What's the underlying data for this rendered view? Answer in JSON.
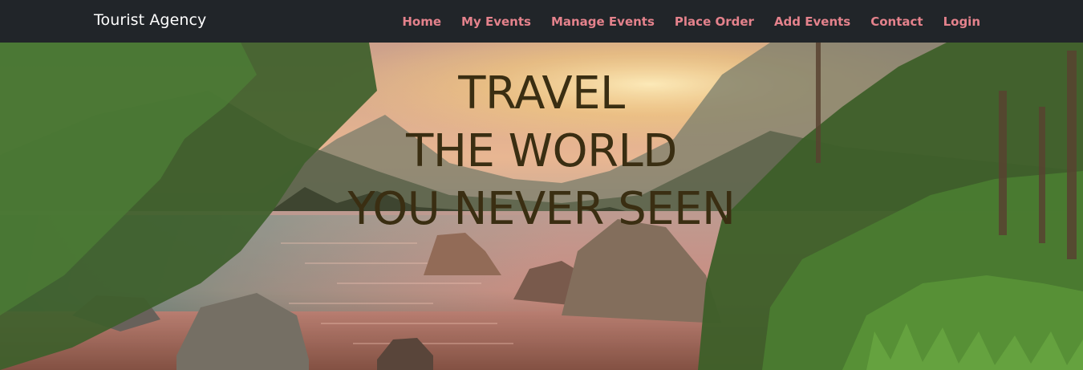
{
  "navbar": {
    "brand": "Tourist Agency",
    "links": [
      {
        "label": "Home"
      },
      {
        "label": "My Events"
      },
      {
        "label": "Manage Events"
      },
      {
        "label": "Place Order"
      },
      {
        "label": "Add Events"
      },
      {
        "label": "Contact"
      },
      {
        "label": "Login"
      }
    ],
    "background": "#212529",
    "link_color": "#e4828c"
  },
  "hero": {
    "lines": [
      "TRAVEL",
      "THE WORLD",
      "YOU NEVER SEEN"
    ],
    "text_color": "#3a2e12",
    "image_description_icon": "mountain-lake-sunset-image"
  }
}
